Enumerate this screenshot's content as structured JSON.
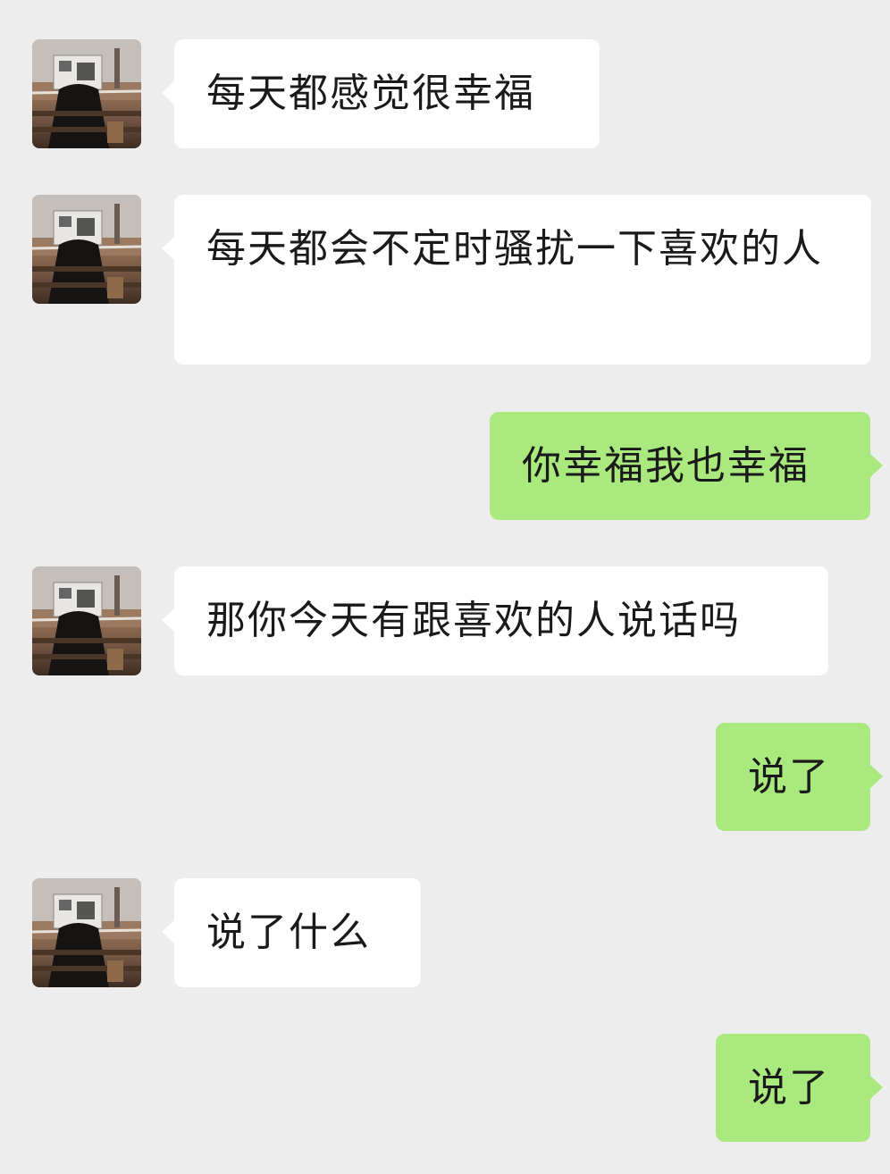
{
  "conversation": {
    "messages": [
      {
        "direction": "incoming",
        "text": "每天都感觉很幸福"
      },
      {
        "direction": "incoming",
        "text": "每天都会不定时骚扰一下喜欢的人"
      },
      {
        "direction": "outgoing",
        "text": "你幸福我也幸福"
      },
      {
        "direction": "incoming",
        "text": "那你今天有跟喜欢的人说话吗"
      },
      {
        "direction": "outgoing",
        "text": "说了"
      },
      {
        "direction": "incoming",
        "text": "说了什么"
      },
      {
        "direction": "outgoing",
        "text": "说了"
      }
    ]
  },
  "colors": {
    "background": "#ededed",
    "incoming_bubble": "#ffffff",
    "outgoing_bubble": "#a9e97d",
    "text": "#1a1a1a"
  },
  "icons": {
    "contact_avatar": "contact-avatar-photo"
  }
}
